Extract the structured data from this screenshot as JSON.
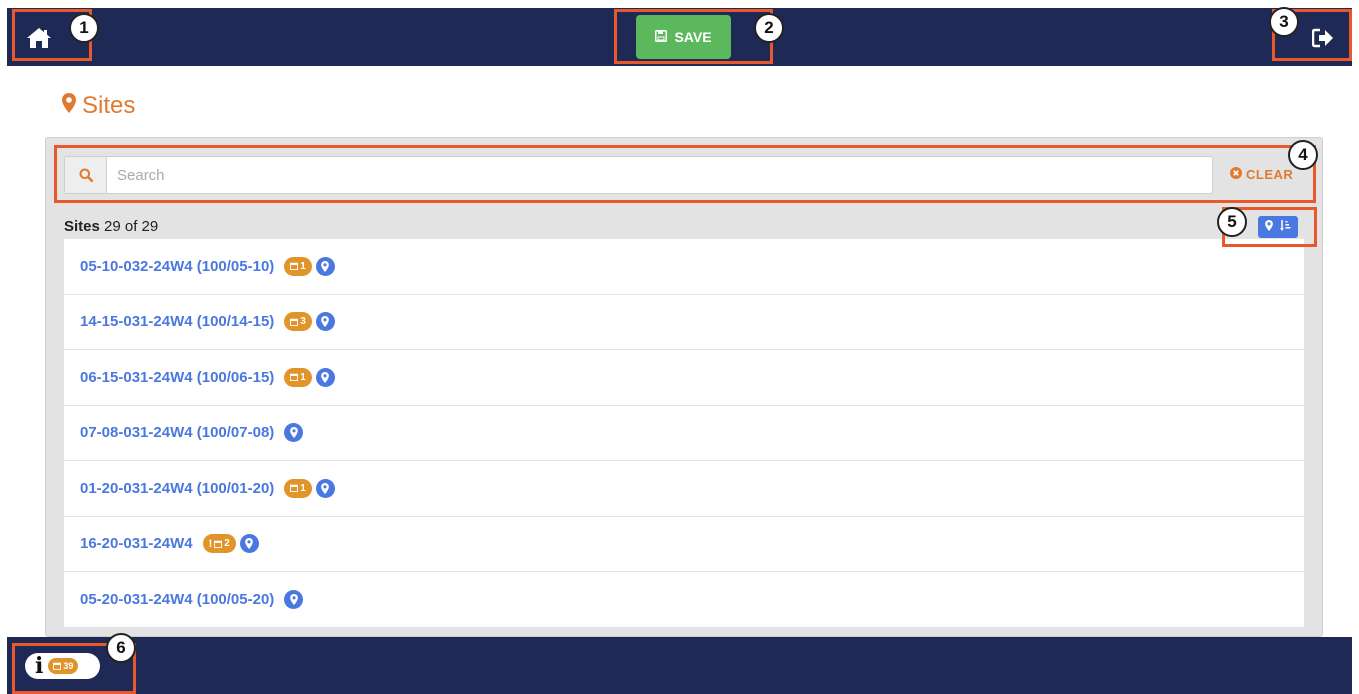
{
  "header": {
    "save_label": "SAVE",
    "icons": {
      "home": "home-icon",
      "save": "floppy-disk-icon",
      "logout": "sign-out-icon"
    }
  },
  "page": {
    "title": "Sites",
    "title_icon": "map-marker-icon"
  },
  "search": {
    "placeholder": "Search",
    "value": "",
    "icon": "search-icon",
    "clear_label": "CLEAR"
  },
  "list": {
    "header_label": "Sites",
    "count_text": "29 of 29",
    "items": [
      {
        "name": "05-10-032-24W4 (100/05-10)",
        "count": "1",
        "alert": false
      },
      {
        "name": "14-15-031-24W4 (100/14-15)",
        "count": "3",
        "alert": false
      },
      {
        "name": "06-15-031-24W4 (100/06-15)",
        "count": "1",
        "alert": false
      },
      {
        "name": "07-08-031-24W4 (100/07-08)",
        "count": null,
        "alert": false
      },
      {
        "name": "01-20-031-24W4 (100/01-20)",
        "count": "1",
        "alert": false
      },
      {
        "name": "16-20-031-24W4",
        "count": "2",
        "alert": true
      },
      {
        "name": "05-20-031-24W4 (100/05-20)",
        "count": null,
        "alert": false
      }
    ]
  },
  "footer": {
    "info_count": "39"
  },
  "callouts": [
    "1",
    "2",
    "3",
    "4",
    "5",
    "6"
  ],
  "colors": {
    "navbar": "#1e2a55",
    "accent_orange": "#e07a30",
    "badge_orange": "#e0942a",
    "link_blue": "#4a78e0",
    "save_green": "#5cb85c",
    "callout_red": "#e8582a"
  }
}
